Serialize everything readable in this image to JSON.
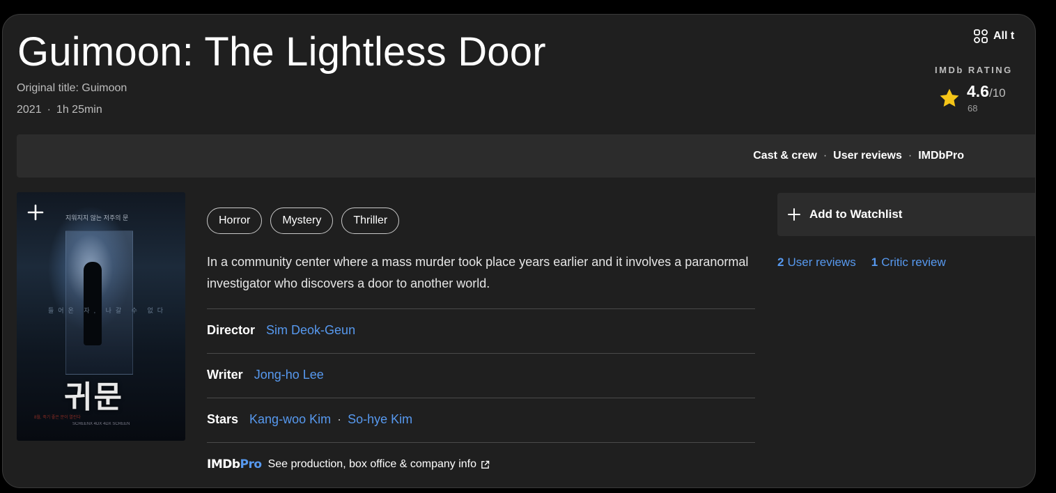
{
  "title": "Guimoon: The Lightless Door",
  "original_title": "Original title: Guimoon",
  "year": "2021",
  "runtime": "1h 25min",
  "rating": {
    "label": "IMDb RATING",
    "value": "4.6",
    "out_of": "/10",
    "count": "68",
    "star_color": "#f5c518"
  },
  "nav": {
    "links": [
      "Cast & crew",
      "User reviews",
      "IMDbPro"
    ],
    "all_topics": "All t"
  },
  "poster": {
    "korean_title": "귀문",
    "tagline": "지워지지 않는 저주의 문",
    "midline": "들어온 자, 나갈 수 없다",
    "credits_line": "SCREENX 4DX 4DX SCREEN",
    "release": "8월, 죽기 좋은 문이 열린다"
  },
  "genres": [
    "Horror",
    "Mystery",
    "Thriller"
  ],
  "plot": "In a community center where a mass murder took place years earlier and it involves a paranormal investigator who discovers a door to another world.",
  "credits": {
    "director_label": "Director",
    "director": "Sim Deok-Geun",
    "writer_label": "Writer",
    "writer": "Jong-ho Lee",
    "stars_label": "Stars",
    "stars": [
      "Kang-woo Kim",
      "So-hye Kim"
    ]
  },
  "imdbpro": {
    "logo_a": "IMDb",
    "logo_b": "Pro",
    "text": "See production, box office & company info"
  },
  "watchlist_label": "Add to Watchlist",
  "reviews": {
    "user_count": "2",
    "user_label": "User reviews",
    "critic_count": "1",
    "critic_label": "Critic review"
  },
  "colors": {
    "link": "#5799ef",
    "background": "#1f1f1f",
    "surface": "#2c2c2c"
  }
}
